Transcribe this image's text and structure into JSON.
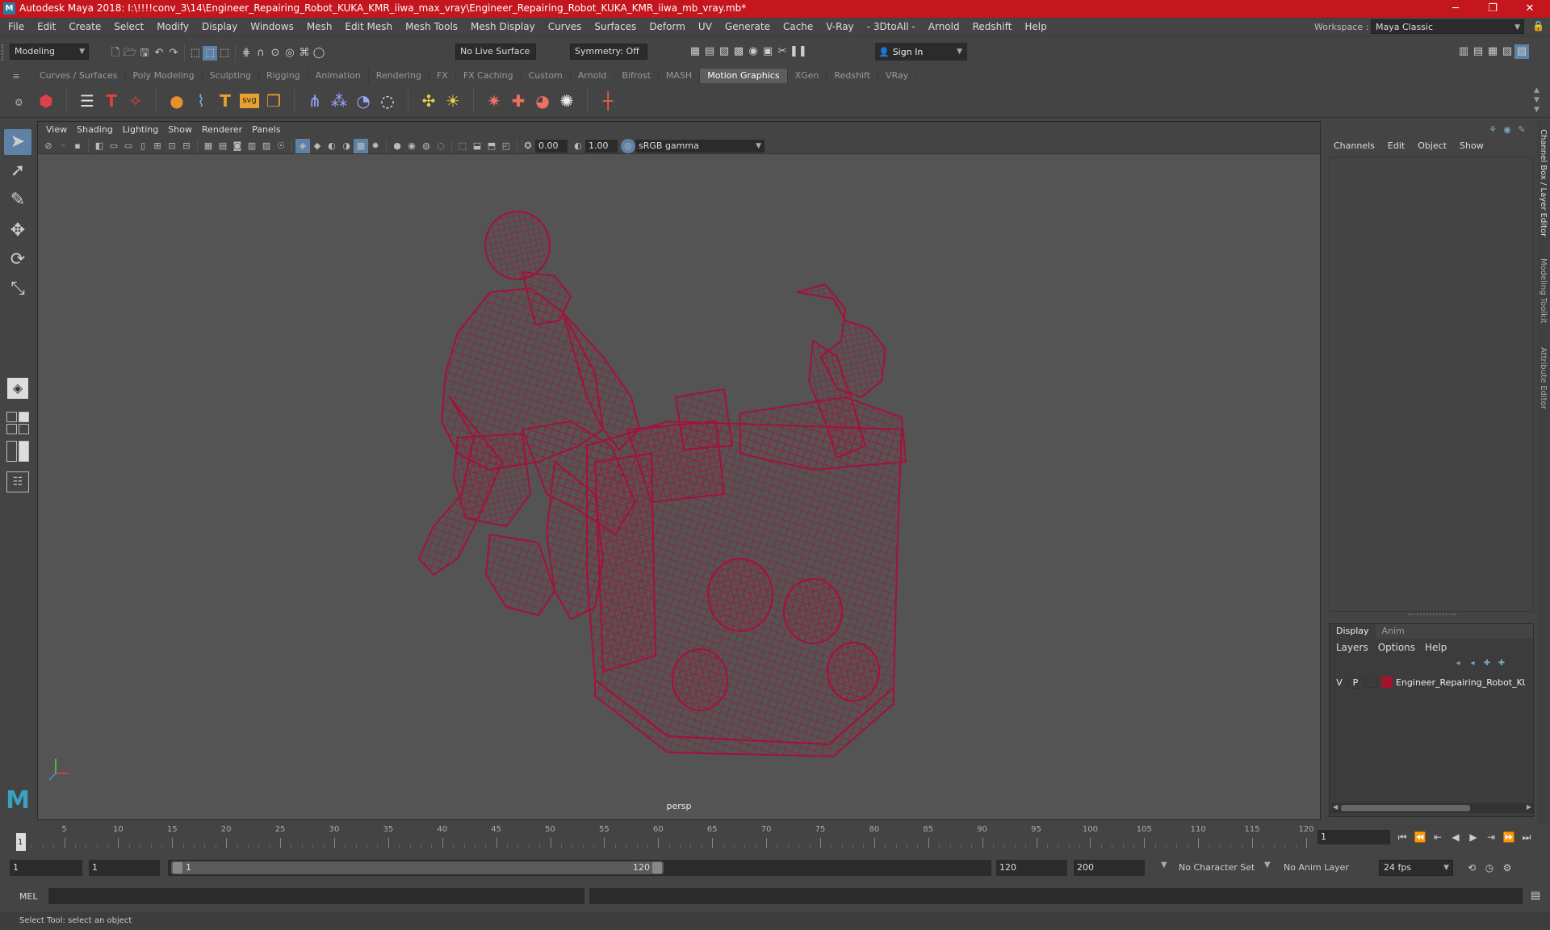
{
  "window": {
    "title": "Autodesk Maya 2018: I:\\!!!!conv_3\\14\\Engineer_Repairing_Robot_KUKA_KMR_iiwa_max_vray\\Engineer_Repairing_Robot_KUKA_KMR_iiwa_mb_vray.mb*",
    "app_icon": "M",
    "minimize": "─",
    "restore": "❐",
    "close": "✕"
  },
  "menubar": {
    "items": [
      "File",
      "Edit",
      "Create",
      "Select",
      "Modify",
      "Display",
      "Windows",
      "Mesh",
      "Edit Mesh",
      "Mesh Tools",
      "Mesh Display",
      "Curves",
      "Surfaces",
      "Deform",
      "UV",
      "Generate",
      "Cache",
      "V-Ray",
      "- 3DtoAll -",
      "Arnold",
      "Redshift",
      "Help"
    ],
    "workspace_label": "Workspace :",
    "workspace_value": "Maya Classic"
  },
  "statusline": {
    "mode": "Modeling",
    "live_surface": "No Live Surface",
    "symmetry": "Symmetry: Off",
    "sign_in": "Sign In"
  },
  "shelf": {
    "tabs": [
      "Curves / Surfaces",
      "Poly Modeling",
      "Sculpting",
      "Rigging",
      "Animation",
      "Rendering",
      "FX",
      "FX Caching",
      "Custom",
      "Arnold",
      "Bifrost",
      "MASH",
      "Motion Graphics",
      "XGen",
      "Redshift",
      "VRay"
    ],
    "active_tab": "Motion Graphics",
    "svg_label": "svg"
  },
  "panel": {
    "menus": [
      "View",
      "Shading",
      "Lighting",
      "Show",
      "Renderer",
      "Panels"
    ],
    "exposure": "0.00",
    "gamma": "1.00",
    "color_space": "sRGB gamma",
    "camera": "persp"
  },
  "channel_box": {
    "menus": [
      "Channels",
      "Edit",
      "Object",
      "Show"
    ],
    "side_tabs": [
      "Channel Box / Layer Editor",
      "Modeling Toolkit",
      "Attribute Editor"
    ]
  },
  "layer_editor": {
    "tabs": [
      "Display",
      "Anim"
    ],
    "active_tab": "Display",
    "menus": [
      "Layers",
      "Options",
      "Help"
    ],
    "layer": {
      "visible": "V",
      "playback": "P",
      "name": "Engineer_Repairing_Robot_KU",
      "color": "#a3132e"
    }
  },
  "timeline": {
    "ticks": [
      "5",
      "10",
      "15",
      "20",
      "25",
      "30",
      "35",
      "40",
      "45",
      "50",
      "55",
      "60",
      "65",
      "70",
      "75",
      "80",
      "85",
      "90",
      "95",
      "100",
      "105",
      "110",
      "115",
      "120"
    ],
    "current_frame_marker": "1",
    "current_frame": "1",
    "range_start": "1",
    "range_inner_start": "1",
    "slider_start": "1",
    "slider_end": "120",
    "range_end": "120",
    "anim_end": "200",
    "character_set": "No Character Set",
    "anim_layer": "No Anim Layer",
    "fps": "24 fps"
  },
  "command_line": {
    "label": "MEL"
  },
  "help_line": {
    "text": "Select Tool: select an object"
  },
  "colors": {
    "title_bar": "#c4161d",
    "wireframe": "#a3123a",
    "viewport_bg": "#545454",
    "active_tool": "#5e82a6"
  }
}
